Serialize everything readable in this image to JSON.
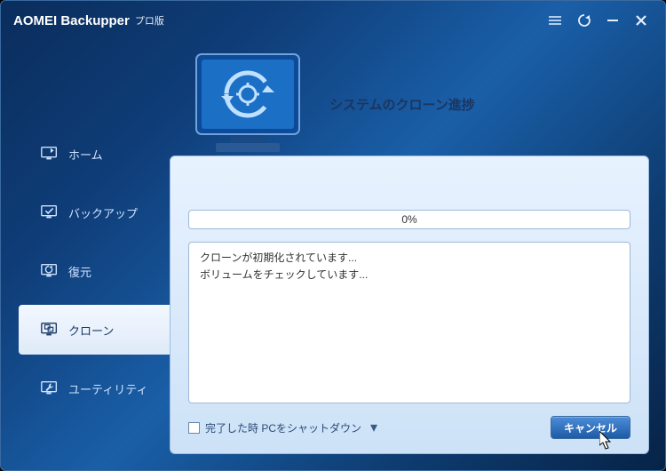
{
  "title": "AOMEI Backupper",
  "edition": "プロ版",
  "sidebar": {
    "items": [
      {
        "label": "ホーム"
      },
      {
        "label": "バックアップ"
      },
      {
        "label": "復元"
      },
      {
        "label": "クローン"
      },
      {
        "label": "ユーティリティ"
      }
    ]
  },
  "panel": {
    "title": "システムのクローン進捗",
    "progress_percent": "0%",
    "log_lines": [
      "クローンが初期化されています...",
      "ボリュームをチェックしています..."
    ]
  },
  "footer": {
    "shutdown_label": "完了した時 PCをシャットダウン",
    "cancel_label": "キャンセル"
  }
}
